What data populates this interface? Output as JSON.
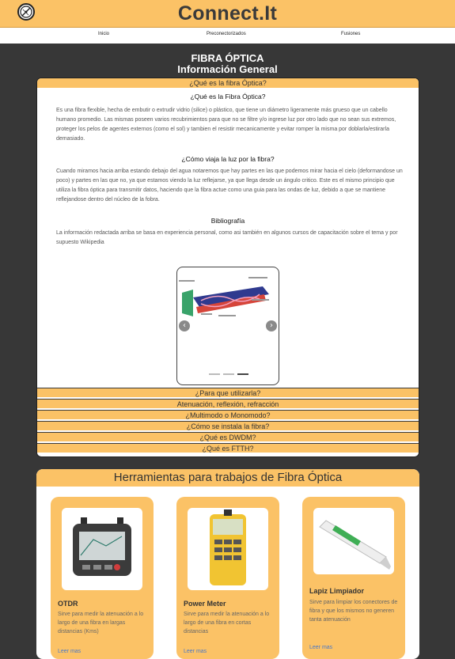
{
  "site": {
    "title": "Connect.It"
  },
  "nav": {
    "items": [
      "Inicio",
      "Preconectorizados",
      "Fusiones"
    ]
  },
  "section": {
    "title": "FIBRA ÓPTICA",
    "subtitle": "Información General"
  },
  "accordion": {
    "open": {
      "header": "¿Qué es la fibra Óptica?",
      "blocks": [
        {
          "heading": "¿Qué es la Fibra Óptica?",
          "text": "Es una fibra flexible, hecha de embutir o extrudir vidrio (silice) o plástico, que tiene un diámetro ligeramente más grueso que un cabello humano promedio. Las mismas poseen varios recubrimientos para que no se filtre y/o ingrese luz por otro lado que no sean sus extremos, proteger los pelos de agentes externos (como el sol) y tambien el resistir mecanicamente y evitar romper la misma por doblarla/estirarla demasiado."
        },
        {
          "heading": "¿Cómo viaja la luz por la fibra?",
          "text": "Cuando miramos hacia arriba estando debajo del agua notaremos que hay partes en las que podemos mirar hacia el cielo (deformandose un poco) y partes en las que no, ya que estamos viendo la luz reflejarse, ya que llega desde un ángulo critico. Este es el mismo principio que utiliza la fibra óptica para transmitir datos, haciendo que la fibra actue como una guia para las ondas de luz, debido a que se mantiene reflejandose dentro del núcleo de la fobra."
        },
        {
          "heading": "Bibliografía",
          "text": "La información redactada arriba se basa en experiencia personal, como asi también en algunos cursos de capacitación sobre el tema y por supuesto Wikipedia"
        }
      ],
      "carousel": {
        "prev_icon": "chevron-left-icon",
        "next_icon": "chevron-right-icon",
        "slides": 3,
        "active": 3
      }
    },
    "collapsed": [
      "¿Para que utilizarla?",
      "Atenuación, reflexión, refracción",
      "¿Multimodo o Monomodo?",
      "¿Cómo se instala la fibra?",
      "¿Qué es DWDM?",
      "¿Qué es FTTH?"
    ]
  },
  "tools": {
    "title": "Herramientas para trabajos de Fibra Óptica",
    "cards": [
      {
        "title": "OTDR",
        "description": "Sirve para medir la atenuación a lo largo de una fibra en largas distancias (Kms)",
        "link": "Leer mas"
      },
      {
        "title": "Power Meter",
        "description": "Sirve para medir la atenuación a lo largo de una fibra en cortas distancias",
        "link": "Leer mas"
      },
      {
        "title": "Lapiz Limpiador",
        "description": "Sirve para limpiar los conectores de fibra y que los mismos no generen tanta atenuación",
        "link": "Leer mas"
      }
    ]
  },
  "colors": {
    "accent": "#fbc266",
    "background": "#373737",
    "link": "#4a78c8"
  }
}
